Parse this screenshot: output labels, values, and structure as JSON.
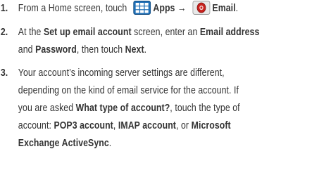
{
  "steps": [
    {
      "number": "1.",
      "t1": "From a Home screen, touch",
      "apps_icon": "apps-grid-icon",
      "apps": "Apps",
      "arrow": "→",
      "email_icon": "email-app-icon",
      "email": "Email",
      "t2": "."
    },
    {
      "number": "2.",
      "t1": "At the ",
      "b1": "Set up email account",
      "t2": " screen, enter an ",
      "b2": "Email address",
      "t3": "and ",
      "b3": "Password",
      "t4": ", then touch ",
      "b4": "Next",
      "t5": "."
    },
    {
      "number": "3.",
      "t1": "Your account’s incoming server settings are different,",
      "t2": "depending on the kind of email service for the account. If",
      "t3": "you are asked ",
      "b1": "What type of account?",
      "t4": ", touch the type of",
      "t5": "account: ",
      "b2": "POP3 account",
      "t6": ", ",
      "b3": "IMAP account",
      "t7": ", or ",
      "b4": "Microsoft",
      "b5": "Exchange ActiveSync",
      "t8": "."
    }
  ],
  "colors": {
    "text": "#333333",
    "apps_icon_blue": "#1f6fb6",
    "email_icon_red": "#c8201c"
  }
}
